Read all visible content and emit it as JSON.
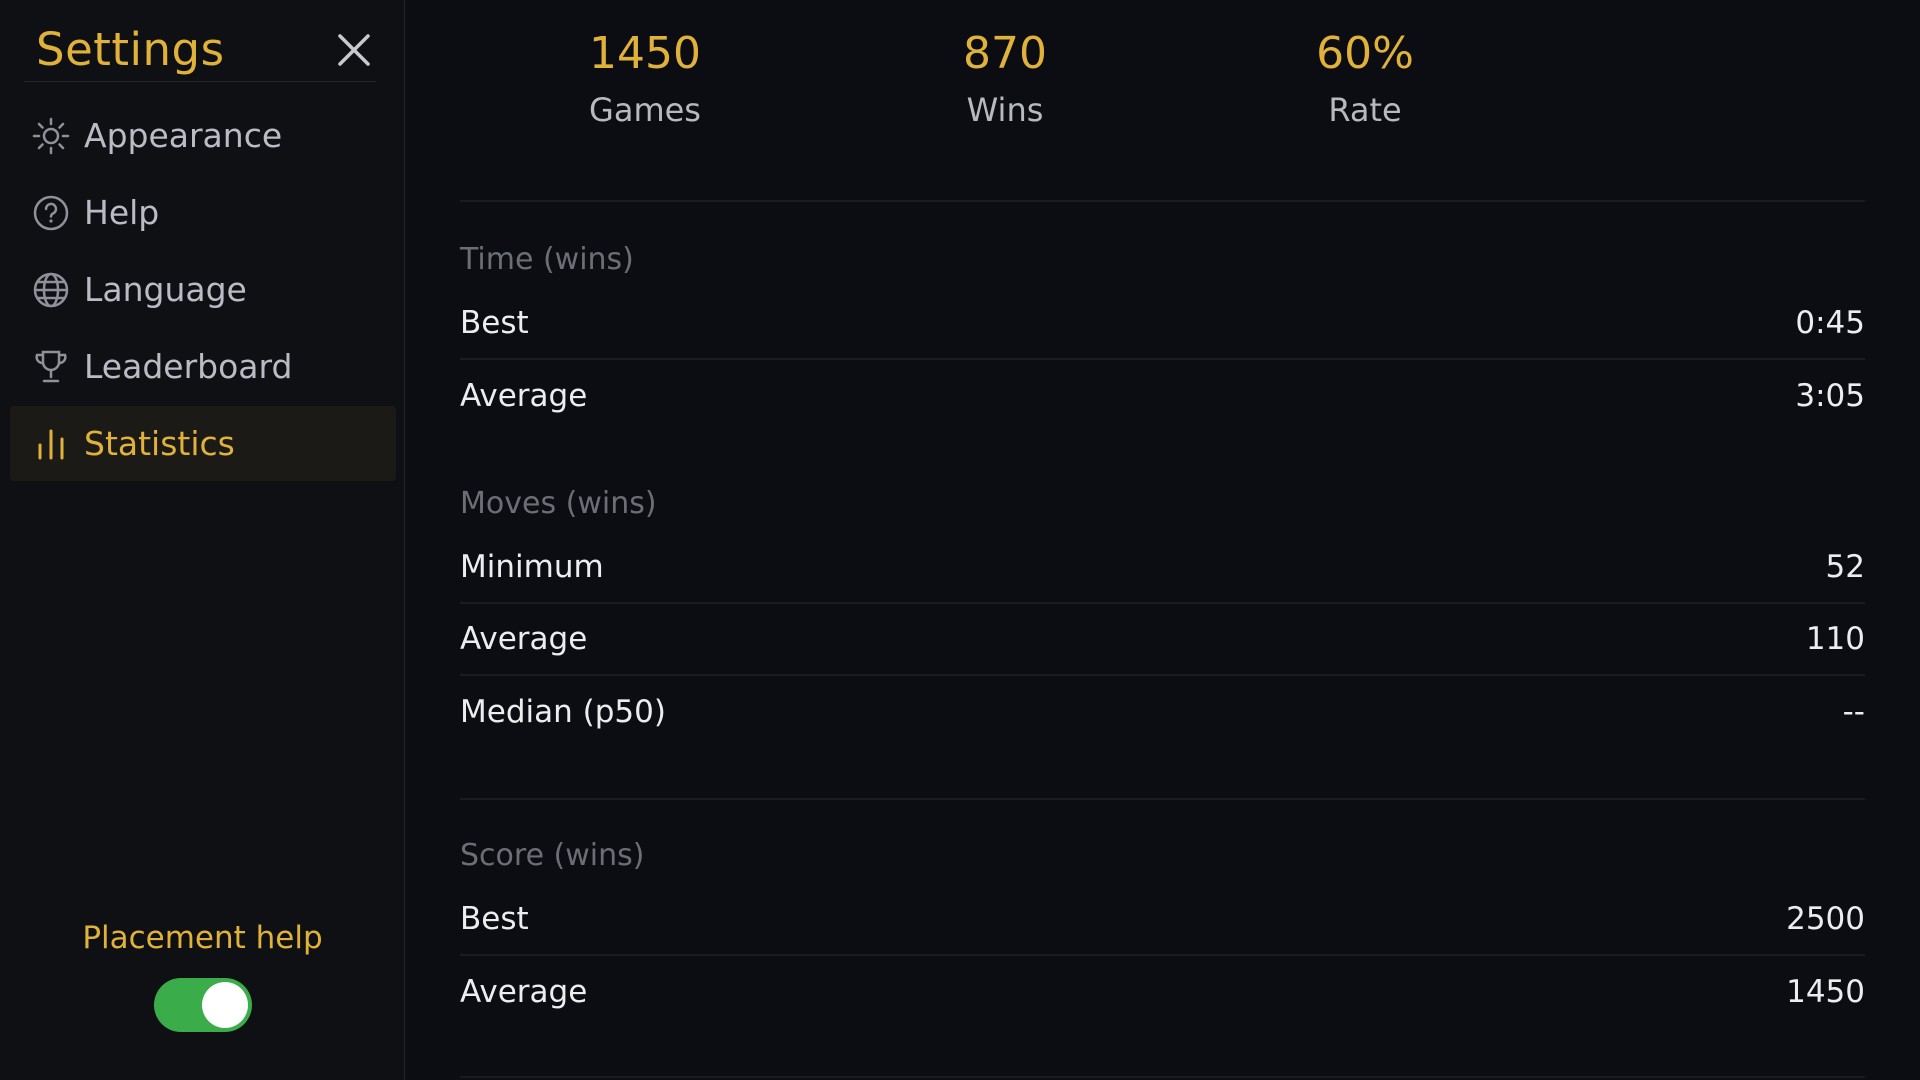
{
  "sidebar": {
    "title": "Settings",
    "items": [
      {
        "label": "Appearance",
        "icon": "sun-icon"
      },
      {
        "label": "Help",
        "icon": "help-icon"
      },
      {
        "label": "Language",
        "icon": "globe-icon"
      },
      {
        "label": "Leaderboard",
        "icon": "trophy-icon"
      },
      {
        "label": "Statistics",
        "icon": "bar-chart-icon",
        "active": true
      }
    ],
    "placement_help": {
      "label": "Placement help",
      "enabled": true
    }
  },
  "summary": {
    "games": {
      "value": "1450",
      "label": "Games"
    },
    "wins": {
      "value": "870",
      "label": "Wins"
    },
    "rate": {
      "value": "60%",
      "label": "Rate"
    }
  },
  "sections": {
    "time": {
      "title": "Time (wins)",
      "rows": [
        {
          "label": "Best",
          "value": "0:45"
        },
        {
          "label": "Average",
          "value": "3:05"
        }
      ]
    },
    "moves": {
      "title": "Moves (wins)",
      "rows": [
        {
          "label": "Minimum",
          "value": "52"
        },
        {
          "label": "Average",
          "value": "110"
        },
        {
          "label": "Median (p50)",
          "value": "--"
        }
      ]
    },
    "score": {
      "title": "Score (wins)",
      "rows": [
        {
          "label": "Best",
          "value": "2500"
        },
        {
          "label": "Average",
          "value": "1450"
        }
      ]
    }
  },
  "colors": {
    "accent": "#e0b23a",
    "background": "#0c0d12",
    "toggle_on": "#3aad4a"
  }
}
